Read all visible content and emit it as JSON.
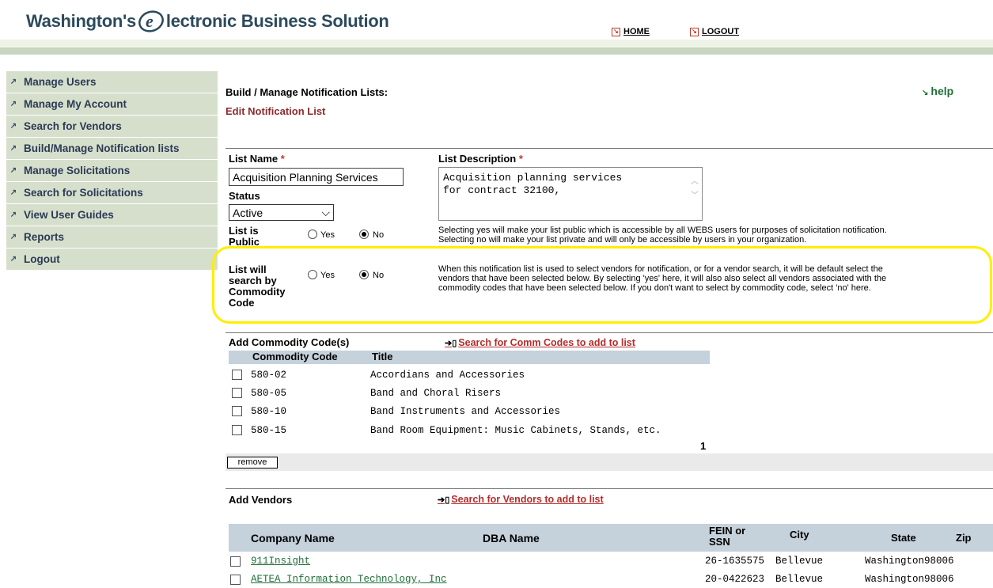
{
  "header": {
    "title_pre": "Washington's",
    "title_post": "lectronic Business Solution",
    "nav": [
      {
        "label": "HOME"
      },
      {
        "label": "LOGOUT"
      }
    ]
  },
  "sidebar": {
    "items": [
      {
        "label": "Manage Users"
      },
      {
        "label": "Manage My Account"
      },
      {
        "label": "Search for Vendors"
      },
      {
        "label": "Build/Manage Notification lists"
      },
      {
        "label": "Manage Solicitations"
      },
      {
        "label": "Search for Solicitations"
      },
      {
        "label": "View User Guides"
      },
      {
        "label": "Reports"
      },
      {
        "label": "Logout"
      }
    ]
  },
  "page": {
    "title": "Build / Manage Notification Lists:",
    "subtitle": "Edit Notification List",
    "help_label": "help"
  },
  "form": {
    "list_name_label": "List Name",
    "list_name_value": "Acquisition Planning Services",
    "required_mark": "*",
    "list_description_label": "List Description",
    "list_description_value": "Acquisition planning services\nfor contract 32100,",
    "status_label": "Status",
    "status_value": "Active",
    "public_label_1": "List is",
    "public_label_2": "Public",
    "yes_label": "Yes",
    "no_label": "No",
    "public_note_1": "Selecting yes will make your list public which is accessible by all WEBS users for purposes of solicitation notification.",
    "public_note_2": "Selecting no will make your list private and will only be accessible by users in your organization.",
    "commodity_label_1": "List will",
    "commodity_label_2": "search by",
    "commodity_label_3": "Commodity",
    "commodity_label_4": "Code",
    "commodity_note_1": "When this notification list is used to select vendors for notification, or for a vendor search, it will be default select the",
    "commodity_note_2": "vendors that have been selected below. By selecting 'yes' here, it will also also select all vendors associated with the",
    "commodity_note_3": "commodity codes that have been selected below. If you don't want to select by commodity code, select 'no' here."
  },
  "commodity": {
    "section_label": "Add Commodity Code(s)",
    "search_link": "Search for Comm Codes to add to list",
    "col_code": "Commodity Code",
    "col_title": "Title",
    "rows": [
      {
        "code": "580-02",
        "title": "Accordians and Accessories"
      },
      {
        "code": "580-05",
        "title": "Band and Choral Risers"
      },
      {
        "code": "580-10",
        "title": "Band Instruments and Accessories"
      },
      {
        "code": "580-15",
        "title": "Band Room Equipment: Music Cabinets, Stands, etc."
      }
    ],
    "page_number": "1",
    "remove_label": "remove"
  },
  "vendors": {
    "section_label": "Add Vendors",
    "search_link": "Search for Vendors to add to list",
    "col_company": "Company Name",
    "col_dba": "DBA Name",
    "col_fein_1": "FEIN or",
    "col_fein_2": "SSN",
    "col_city": "City",
    "col_state": "State",
    "col_zip": "Zip",
    "rows": [
      {
        "company": "911Insight",
        "fein": "26-1635575",
        "city": "Bellevue",
        "state": "Washington",
        "zip": "98006"
      },
      {
        "company": "AETEA Information Technology, Inc",
        "fein": "20-0422623",
        "city": "Bellevue",
        "state": "Washington",
        "zip": "98006"
      }
    ]
  },
  "colors": {
    "title": "#2c4a5c",
    "sidebar_bg": "#d6dfcc",
    "accent_red": "#8b2c2c",
    "link_green": "#1f6f38",
    "highlight": "#ffee00",
    "table_header": "#c5d1db"
  }
}
